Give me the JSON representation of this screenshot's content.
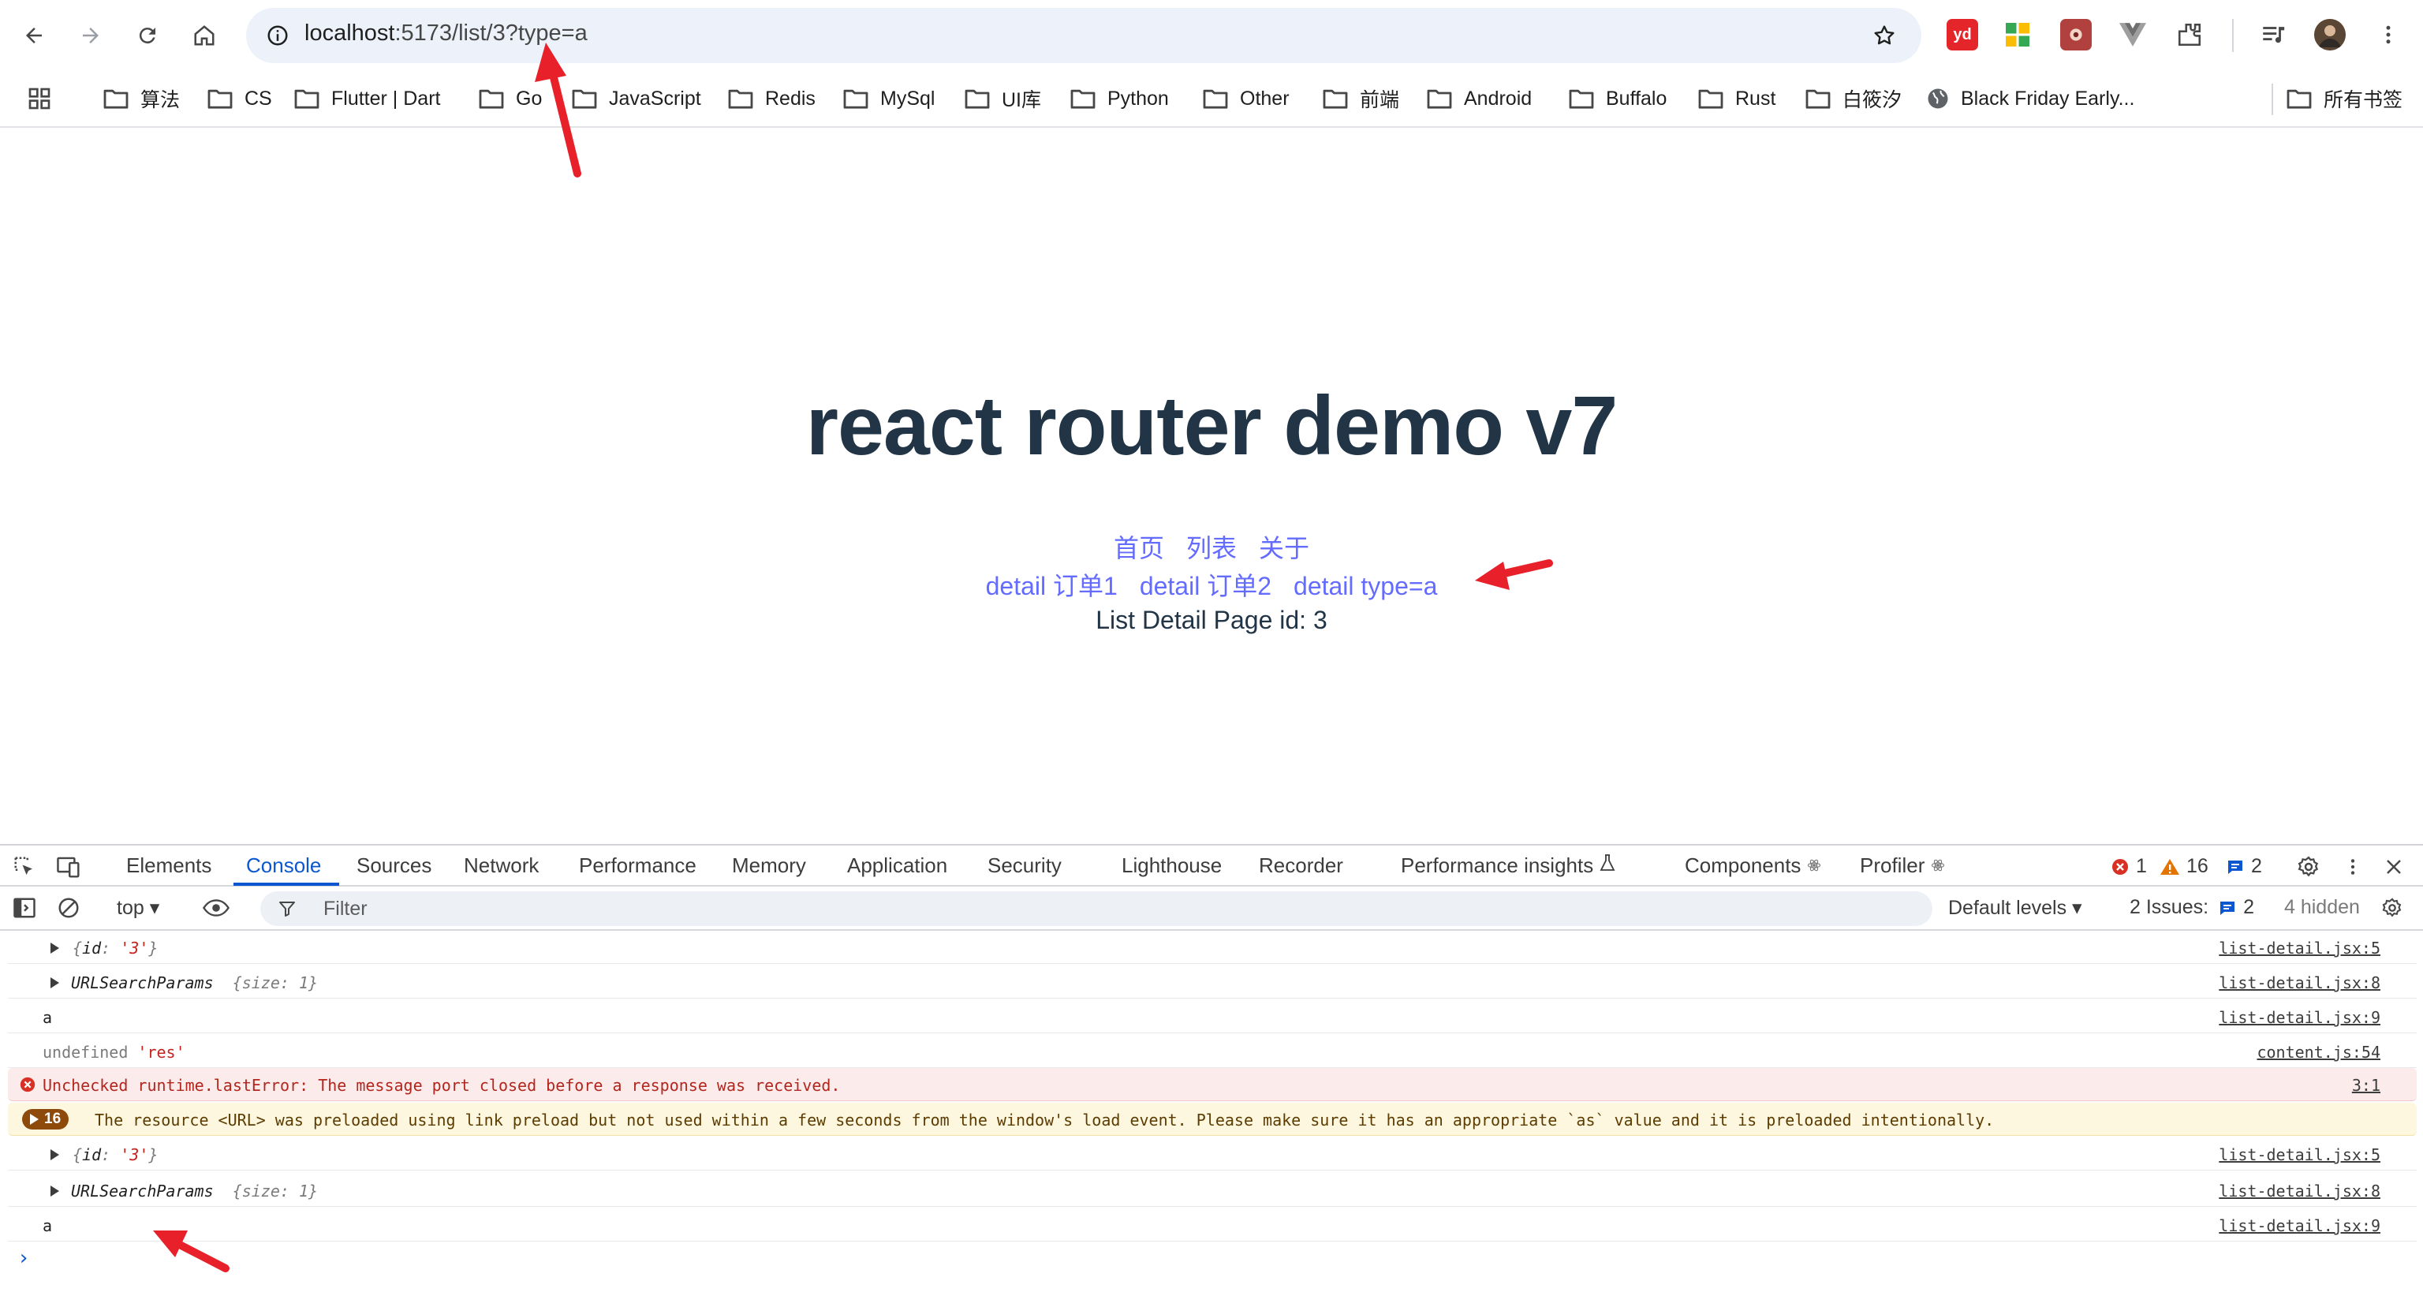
{
  "browser": {
    "url_host": "localhost",
    "url_path": ":5173/list/3?type=a"
  },
  "extensions": [
    {
      "icon": "youdao-icon",
      "label": "yd",
      "color": "#e4262a"
    },
    {
      "icon": "grid-extension-icon",
      "label": "",
      "color": "#34a853"
    },
    {
      "icon": "red-extension-icon",
      "label": "",
      "color": "#b0413e"
    },
    {
      "icon": "vue-devtools-icon",
      "label": "",
      "color": "#8e8e8e"
    },
    {
      "icon": "puzzle-icon",
      "label": "",
      "color": "#474747"
    }
  ],
  "bookmarks": [
    "算法",
    "CS",
    "Flutter | Dart",
    "Go",
    "JavaScript",
    "Redis",
    "MySql",
    "UI库",
    "Python",
    "Other",
    "前端",
    "Android",
    "Buffalo",
    "Rust",
    "白筱汐",
    "Black Friday Early..."
  ],
  "bookmarks_all": "所有书签",
  "page": {
    "title": "react router demo v7",
    "nav_links": [
      "首页",
      "列表",
      "关于"
    ],
    "detail_links": [
      "detail 订单1",
      "detail 订单2",
      "detail type=a"
    ],
    "detail_text": "List Detail Page id: 3",
    "link_color": "#646cff",
    "text_color": "#213547"
  },
  "devtools": {
    "tabs": [
      "Elements",
      "Console",
      "Sources",
      "Network",
      "Performance",
      "Memory",
      "Application",
      "Security",
      "Lighthouse",
      "Recorder",
      "Performance insights",
      "Components",
      "Profiler"
    ],
    "active_tab": "Console",
    "error_count": "1",
    "warning_count": "16",
    "info_count": "2",
    "context": "top",
    "filter_placeholder": "Filter",
    "levels": "Default levels",
    "issues_label": "2 Issues:",
    "issues_count": "2",
    "hidden": "4 hidden"
  },
  "console": {
    "r1": {
      "key": "id",
      "value": "'3'",
      "src": "list-detail.jsx:5"
    },
    "r2": {
      "name": "URLSearchParams",
      "meta": "{size: 1}",
      "src": "list-detail.jsx:8"
    },
    "r3": {
      "text": "a",
      "src": "list-detail.jsx:9"
    },
    "r4": {
      "text": "undefined",
      "str": "'res'",
      "src": "content.js:54"
    },
    "r5": {
      "text": "Unchecked runtime.lastError: The message port closed before a response was received.",
      "src": "3:1"
    },
    "r6": {
      "count": "16",
      "text": "The resource <URL> was preloaded using link preload but not used within a few seconds from the window's load event. Please make sure it has an appropriate `as` value and it is preloaded intentionally."
    },
    "r7": {
      "key": "id",
      "value": "'3'",
      "src": "list-detail.jsx:5"
    },
    "r8": {
      "name": "URLSearchParams",
      "meta": "{size: 1}",
      "src": "list-detail.jsx:8"
    },
    "r9": {
      "text": "a",
      "src": "list-detail.jsx:9"
    },
    "prompt": "›"
  }
}
